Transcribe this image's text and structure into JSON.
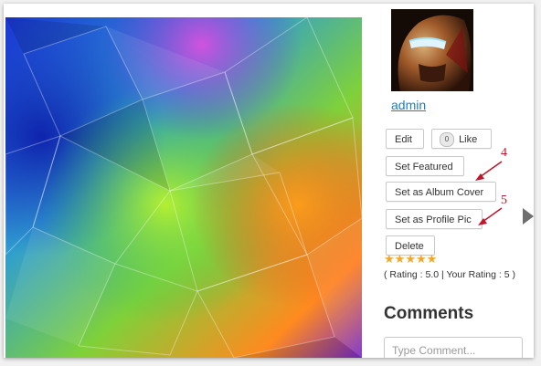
{
  "photo": {
    "description_icon": "abstract-photo"
  },
  "sidebar": {
    "avatar_icon": "ironman-avatar",
    "username": "admin",
    "buttons": {
      "edit": "Edit",
      "like_count": "0",
      "like": "Like",
      "set_featured": "Set Featured",
      "set_album_cover": "Set as Album Cover",
      "set_profile_pic": "Set as Profile Pic",
      "delete": "Delete"
    },
    "rating": {
      "stars": 5,
      "text": "( Rating : 5.0 | Your Rating : 5 )"
    },
    "comments": {
      "title": "Comments",
      "placeholder": "Type Comment..."
    }
  },
  "annotations": {
    "label_4": "4",
    "label_5": "5"
  },
  "navigation": {
    "next_icon": "next-photo-arrow"
  },
  "colors": {
    "link": "#1a7fc1",
    "star": "#f5a623",
    "annotation": "#c0152a"
  }
}
